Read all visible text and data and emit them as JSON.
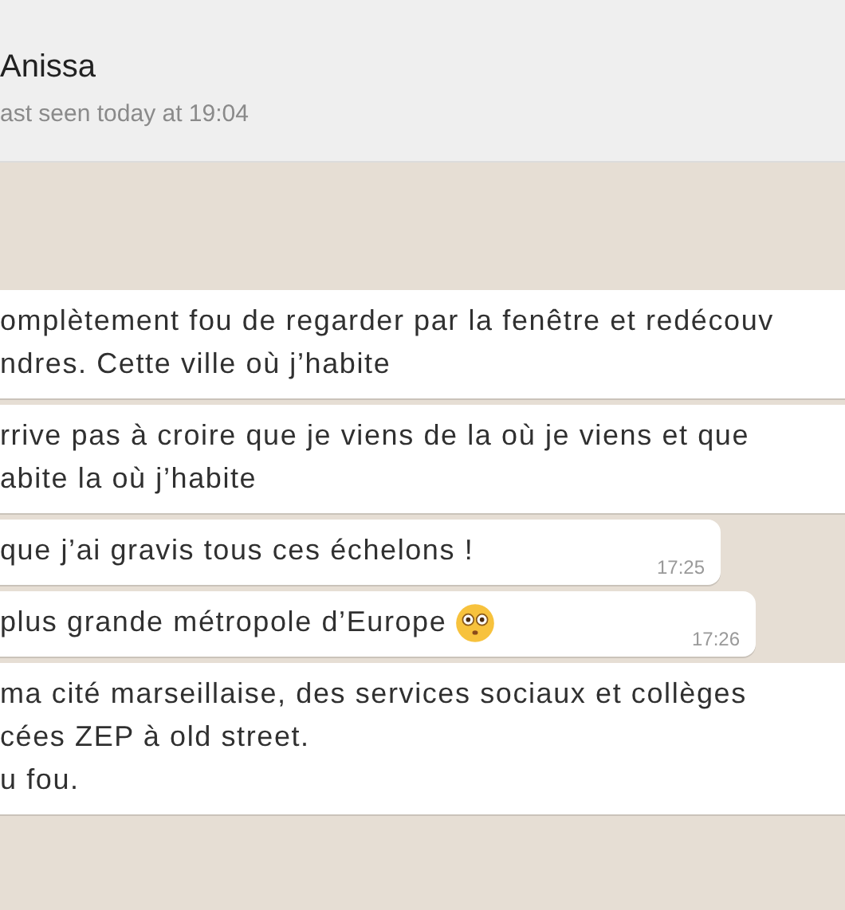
{
  "header": {
    "contact_name": "Anissa",
    "status": "ast seen today at 19:04"
  },
  "messages": [
    {
      "lines": [
        "omplètement fou de regarder par la fenêtre et redécouv",
        "ndres. Cette ville où j’habite"
      ]
    },
    {
      "lines": [
        "rrive pas à croire que je viens de la où je viens et que",
        "abite la où j’habite"
      ]
    },
    {
      "lines": [
        "que j’ai gravis tous ces échelons !"
      ],
      "time": "17:25"
    },
    {
      "lines": [
        "plus grande métropole d’Europe"
      ],
      "has_emoji": true,
      "time": "17:26"
    },
    {
      "lines": [
        "ma cité marseillaise, des services sociaux et collèges",
        "cées ZEP à old street.",
        "u fou."
      ]
    }
  ]
}
